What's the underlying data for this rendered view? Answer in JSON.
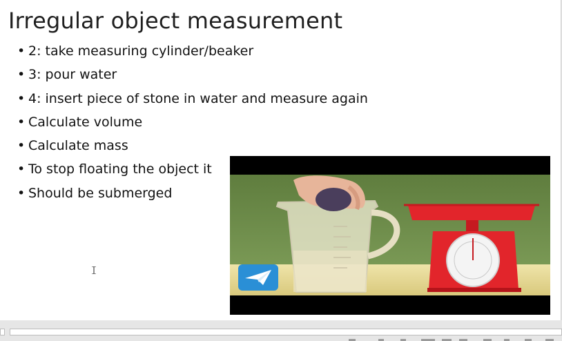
{
  "slide": {
    "title": "Irregular object measurement",
    "bullets": [
      "2: take measuring cylinder/beaker",
      "3: pour water",
      "4: insert piece of stone in water and measure again",
      "Calculate volume",
      "Calculate mass",
      "To stop floating the object it",
      "Should be submerged"
    ],
    "bullet_char": "•"
  },
  "video": {
    "icons": [
      "paper-plane-icon",
      "kitchen-scale-icon",
      "measuring-jug-icon"
    ]
  },
  "colors": {
    "scale_red": "#e2252b",
    "wall_green": "#6d8c4a",
    "table_tan": "#e9dc9a",
    "logo_blue": "#2a8fd6"
  }
}
